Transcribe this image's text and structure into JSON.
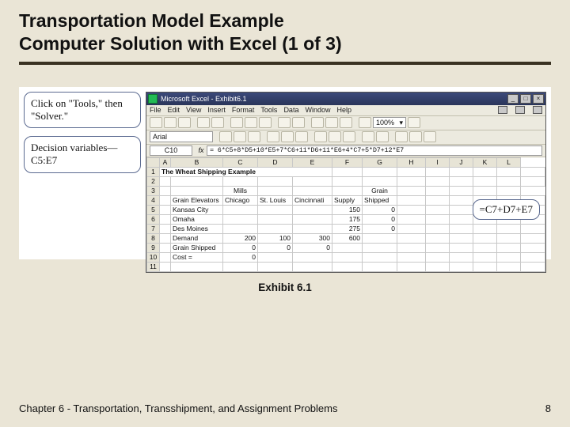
{
  "title_line1": "Transportation Model Example",
  "title_line2": "Computer Solution with Excel (1 of 3)",
  "callouts": {
    "tools": "Click on \"Tools,\" then \"Solver.\"",
    "dv": "Decision variables—C5:E7",
    "formula_right": "=C7+D7+E7"
  },
  "excel": {
    "title": "Microsoft Excel - Exhibit6.1",
    "menu": [
      "File",
      "Edit",
      "View",
      "Insert",
      "Format",
      "Tools",
      "Data",
      "Window",
      "Help"
    ],
    "font": "Arial",
    "zoom": "100%",
    "namebox": "C10",
    "formula": "= 6*C5+8*D5+10*E5+7*C6+11*D6+11*E6+4*C7+5*D7+12*E7",
    "cols": [
      "",
      "A",
      "B",
      "C",
      "D",
      "E",
      "F",
      "G",
      "H",
      "I",
      "J",
      "K",
      "L"
    ],
    "rows": [
      {
        "n": "1",
        "cells": [
          {
            "t": "The Wheat Shipping Example",
            "cls": "bold",
            "span": 5
          },
          "",
          "",
          "",
          "",
          "",
          "",
          "",
          ""
        ]
      },
      {
        "n": "2",
        "cells": [
          "",
          "",
          "",
          "",
          "",
          "",
          "",
          "",
          "",
          "",
          "",
          "",
          ""
        ]
      },
      {
        "n": "3",
        "cells": [
          "",
          "",
          {
            "t": "Mills",
            "cls": "c"
          },
          "",
          "",
          "",
          {
            "t": "Grain",
            "cls": "c"
          },
          "",
          "",
          "",
          "",
          ""
        ]
      },
      {
        "n": "4",
        "cells": [
          "",
          "Grain Elevators",
          "Chicago",
          "St. Louis",
          "Cincinnati",
          "Supply",
          "Shipped",
          "",
          "",
          "",
          "",
          "",
          ""
        ]
      },
      {
        "n": "5",
        "cells": [
          "",
          "Kansas City",
          "",
          "",
          "",
          {
            "t": "150",
            "cls": "r"
          },
          {
            "t": "0",
            "cls": "r"
          },
          "",
          "",
          "",
          "",
          "",
          ""
        ]
      },
      {
        "n": "6",
        "cells": [
          "",
          "Omaha",
          "",
          "",
          "",
          {
            "t": "175",
            "cls": "r"
          },
          {
            "t": "0",
            "cls": "r"
          },
          "",
          "",
          "",
          "",
          "",
          ""
        ]
      },
      {
        "n": "7",
        "cells": [
          "",
          "Des Moines",
          "",
          "",
          "",
          {
            "t": "275",
            "cls": "r"
          },
          {
            "t": "0",
            "cls": "r"
          },
          "",
          "",
          "",
          "",
          "",
          ""
        ]
      },
      {
        "n": "8",
        "cells": [
          "",
          "Demand",
          {
            "t": "200",
            "cls": "r"
          },
          {
            "t": "100",
            "cls": "r"
          },
          {
            "t": "300",
            "cls": "r"
          },
          {
            "t": "600",
            "cls": "r"
          },
          "",
          "",
          "",
          "",
          "",
          "",
          ""
        ]
      },
      {
        "n": "9",
        "cells": [
          "",
          "Grain Shipped",
          {
            "t": "0",
            "cls": "r"
          },
          {
            "t": "0",
            "cls": "r"
          },
          {
            "t": "0",
            "cls": "r"
          },
          "",
          "",
          "",
          "",
          "",
          "",
          "",
          ""
        ]
      },
      {
        "n": "10",
        "cells": [
          "",
          "Cost =",
          {
            "t": "0",
            "cls": "r"
          },
          "",
          "",
          "",
          "",
          "",
          "",
          "",
          "",
          "",
          ""
        ]
      },
      {
        "n": "11",
        "cells": [
          "",
          "",
          "",
          "",
          "",
          "",
          "",
          "",
          "",
          "",
          "",
          "",
          ""
        ]
      }
    ]
  },
  "exhibit": "Exhibit 6.1",
  "footer_left": "Chapter 6 - Transportation, Transshipment, and Assignment Problems",
  "footer_right": "8"
}
